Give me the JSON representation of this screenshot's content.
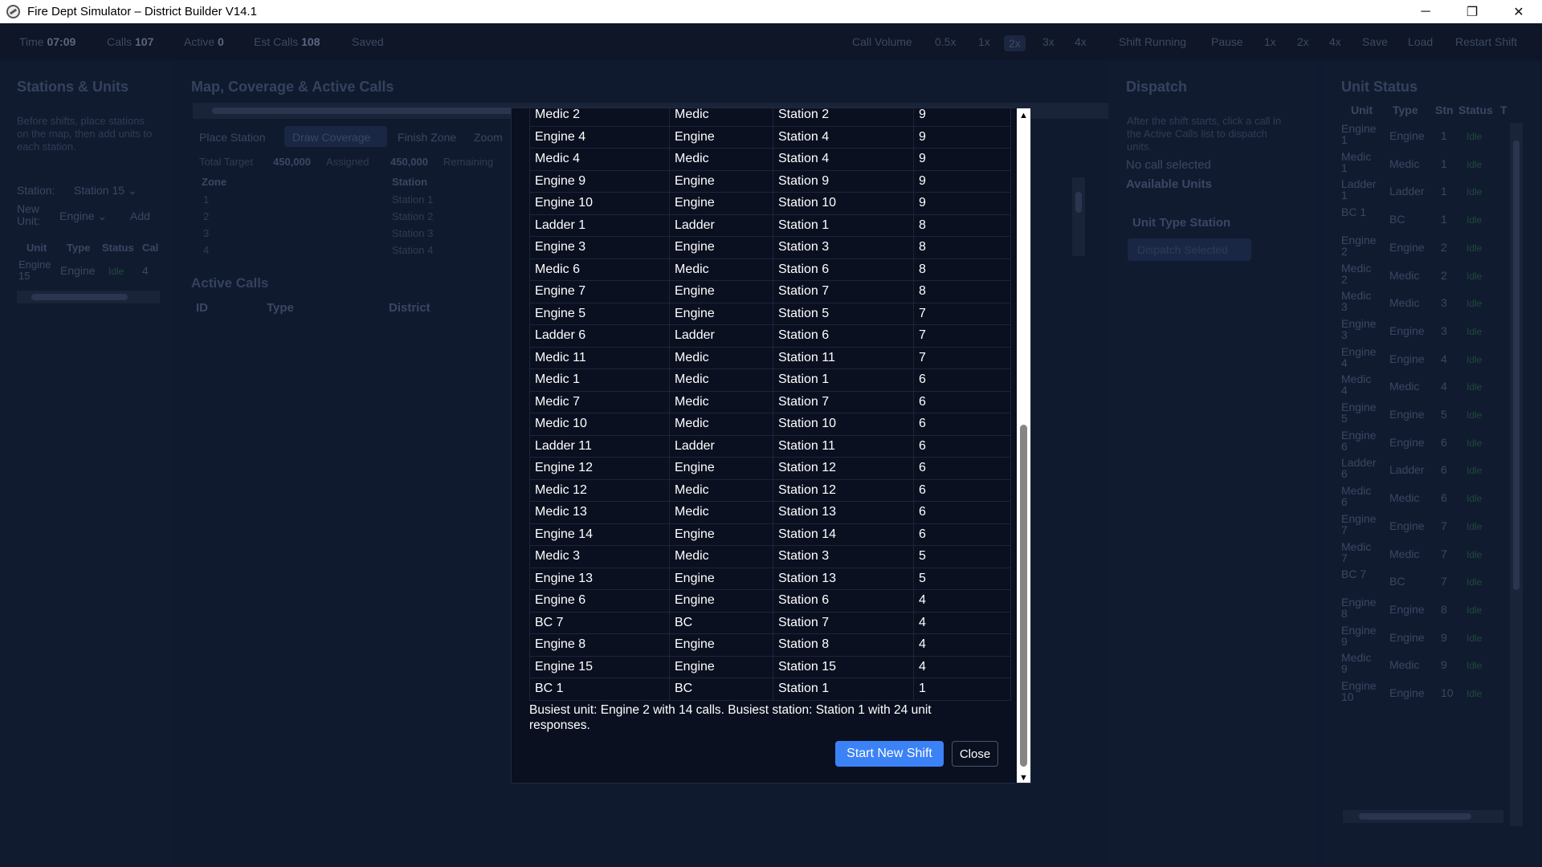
{
  "window": {
    "title": "Fire Dept Simulator – District Builder V14.1",
    "minimize": "─",
    "restore": "❐",
    "close": "✕"
  },
  "topbar": {
    "time_label": "Time",
    "time_value": "07:09",
    "calls_label": "Calls",
    "calls_value": "107",
    "active_label": "Active",
    "active_value": "0",
    "est_label": "Est Calls",
    "est_value": "108",
    "saved": "Saved",
    "call_volume_label": "Call Volume",
    "volume_options": [
      "0.5x",
      "1x",
      "2x",
      "3x",
      "4x"
    ],
    "shift_running": "Shift Running",
    "pause": "Pause",
    "speed_options": [
      "1x",
      "2x",
      "4x"
    ],
    "save": "Save",
    "load": "Load",
    "restart": "Restart Shift"
  },
  "stations_panel": {
    "title": "Stations & Units",
    "help": "Before shifts, place stations on the map, then add units to each station.",
    "station_label": "Station:",
    "station_value": "Station 15",
    "new_unit_label": "New Unit:",
    "new_unit_value": "Engine",
    "add_label": "Add",
    "columns": [
      "Unit",
      "Type",
      "Status",
      "Cal"
    ],
    "row": {
      "unit": "Engine 15",
      "type": "Engine",
      "status": "Idle",
      "calls": "4"
    }
  },
  "map_panel": {
    "title": "Map, Coverage & Active Calls",
    "tools": [
      "Place Station",
      "Draw Coverage",
      "Finish Zone",
      "Zoom"
    ],
    "total_target_label": "Total Target",
    "total_target_value": "450,000",
    "assigned_label": "Assigned",
    "assigned_value": "450,000",
    "remaining_label": "Remaining",
    "zone_headers": [
      "Zone",
      "Station"
    ],
    "zones": [
      {
        "zone": "1",
        "station": "Station 1"
      },
      {
        "zone": "2",
        "station": "Station 2"
      },
      {
        "zone": "3",
        "station": "Station 3"
      },
      {
        "zone": "4",
        "station": "Station 4"
      }
    ],
    "active_calls_title": "Active Calls",
    "active_calls_headers": [
      "ID",
      "Type",
      "District"
    ]
  },
  "dispatch_panel": {
    "title": "Dispatch",
    "help": "After the shift starts, click a call in the Active Calls list to dispatch units.",
    "no_call": "No call selected",
    "available_units": "Available Units",
    "table_headers": "Unit Type Station",
    "dispatch_button": "Dispatch Selected"
  },
  "unit_status_panel": {
    "title": "Unit Status",
    "headers": [
      "Unit",
      "Type",
      "Stn",
      "Status",
      "T"
    ],
    "rows": [
      {
        "unit": "Engine 1",
        "type": "Engine",
        "stn": "1",
        "status": "Idle"
      },
      {
        "unit": "Medic 1",
        "type": "Medic",
        "stn": "1",
        "status": "Idle"
      },
      {
        "unit": "Ladder 1",
        "type": "Ladder",
        "stn": "1",
        "status": "Idle"
      },
      {
        "unit": "BC 1",
        "type": "BC",
        "stn": "1",
        "status": "Idle"
      },
      {
        "unit": "Engine 2",
        "type": "Engine",
        "stn": "2",
        "status": "Idle"
      },
      {
        "unit": "Medic 2",
        "type": "Medic",
        "stn": "2",
        "status": "Idle"
      },
      {
        "unit": "Medic 3",
        "type": "Medic",
        "stn": "3",
        "status": "Idle"
      },
      {
        "unit": "Engine 3",
        "type": "Engine",
        "stn": "3",
        "status": "Idle"
      },
      {
        "unit": "Engine 4",
        "type": "Engine",
        "stn": "4",
        "status": "Idle"
      },
      {
        "unit": "Medic 4",
        "type": "Medic",
        "stn": "4",
        "status": "Idle"
      },
      {
        "unit": "Engine 5",
        "type": "Engine",
        "stn": "5",
        "status": "Idle"
      },
      {
        "unit": "Engine 6",
        "type": "Engine",
        "stn": "6",
        "status": "Idle"
      },
      {
        "unit": "Ladder 6",
        "type": "Ladder",
        "stn": "6",
        "status": "Idle"
      },
      {
        "unit": "Medic 6",
        "type": "Medic",
        "stn": "6",
        "status": "Idle"
      },
      {
        "unit": "Engine 7",
        "type": "Engine",
        "stn": "7",
        "status": "Idle"
      },
      {
        "unit": "Medic 7",
        "type": "Medic",
        "stn": "7",
        "status": "Idle"
      },
      {
        "unit": "BC 7",
        "type": "BC",
        "stn": "7",
        "status": "Idle"
      },
      {
        "unit": "Engine 8",
        "type": "Engine",
        "stn": "8",
        "status": "Idle"
      },
      {
        "unit": "Engine 9",
        "type": "Engine",
        "stn": "9",
        "status": "Idle"
      },
      {
        "unit": "Medic 9",
        "type": "Medic",
        "stn": "9",
        "status": "Idle"
      },
      {
        "unit": "Engine 10",
        "type": "Engine",
        "stn": "10",
        "status": "Idle"
      }
    ]
  },
  "modal": {
    "rows": [
      [
        "Medic 2",
        "Medic",
        "Station 2",
        "9"
      ],
      [
        "Engine 4",
        "Engine",
        "Station 4",
        "9"
      ],
      [
        "Medic 4",
        "Medic",
        "Station 4",
        "9"
      ],
      [
        "Engine 9",
        "Engine",
        "Station 9",
        "9"
      ],
      [
        "Engine 10",
        "Engine",
        "Station 10",
        "9"
      ],
      [
        "Ladder 1",
        "Ladder",
        "Station 1",
        "8"
      ],
      [
        "Engine 3",
        "Engine",
        "Station 3",
        "8"
      ],
      [
        "Medic 6",
        "Medic",
        "Station 6",
        "8"
      ],
      [
        "Engine 7",
        "Engine",
        "Station 7",
        "8"
      ],
      [
        "Engine 5",
        "Engine",
        "Station 5",
        "7"
      ],
      [
        "Ladder 6",
        "Ladder",
        "Station 6",
        "7"
      ],
      [
        "Medic 11",
        "Medic",
        "Station 11",
        "7"
      ],
      [
        "Medic 1",
        "Medic",
        "Station 1",
        "6"
      ],
      [
        "Medic 7",
        "Medic",
        "Station 7",
        "6"
      ],
      [
        "Medic 10",
        "Medic",
        "Station 10",
        "6"
      ],
      [
        "Ladder 11",
        "Ladder",
        "Station 11",
        "6"
      ],
      [
        "Engine 12",
        "Engine",
        "Station 12",
        "6"
      ],
      [
        "Medic 12",
        "Medic",
        "Station 12",
        "6"
      ],
      [
        "Medic 13",
        "Medic",
        "Station 13",
        "6"
      ],
      [
        "Engine 14",
        "Engine",
        "Station 14",
        "6"
      ],
      [
        "Medic 3",
        "Medic",
        "Station 3",
        "5"
      ],
      [
        "Engine 13",
        "Engine",
        "Station 13",
        "5"
      ],
      [
        "Engine 6",
        "Engine",
        "Station 6",
        "4"
      ],
      [
        "BC 7",
        "BC",
        "Station 7",
        "4"
      ],
      [
        "Engine 8",
        "Engine",
        "Station 8",
        "4"
      ],
      [
        "Engine 15",
        "Engine",
        "Station 15",
        "4"
      ],
      [
        "BC 1",
        "BC",
        "Station 1",
        "1"
      ]
    ],
    "summary": "Busiest unit: Engine 2 with 14 calls. Busiest station: Station 1 with 24 unit responses.",
    "start_button": "Start New Shift",
    "close_button": "Close",
    "scroll_up": "▲",
    "scroll_down": "▼"
  }
}
